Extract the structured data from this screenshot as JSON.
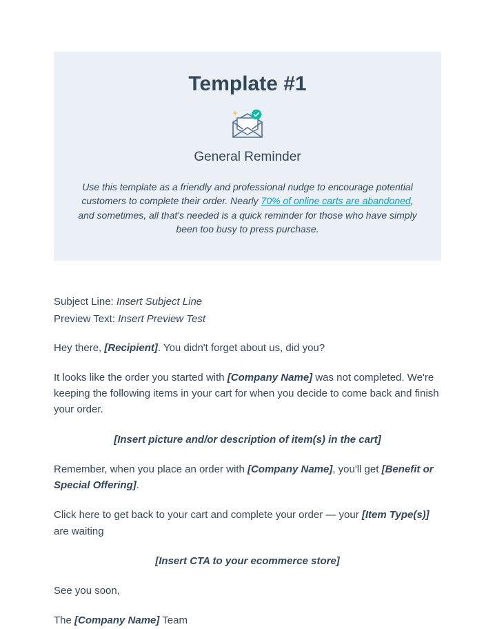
{
  "header": {
    "title": "Template #1",
    "subtitle": "General Reminder",
    "intro_pre": "Use this template as a friendly and professional nudge to encourage potential customers to complete their order. Nearly ",
    "intro_link": "70% of online carts are abandoned",
    "intro_post": ", and sometimes, all that's needed is a quick reminder for those who have simply been too busy to press purchase."
  },
  "meta": {
    "subject_label": "Subject Line: ",
    "subject_value": "Insert Subject Line",
    "preview_label": "Preview Text: ",
    "preview_value": "Insert Preview Test"
  },
  "body": {
    "greeting_pre": "Hey there, ",
    "greeting_recipient": "[Recipient]",
    "greeting_post": ". You didn't forget about us, did you?",
    "p2_pre": "It looks like the order you started with ",
    "p2_company": "[Company Name]",
    "p2_post": " was not completed. We're keeping the following items in your cart for when you decide to come back and finish your order.",
    "insert_picture": "[Insert picture and/or description of item(s) in the cart]",
    "p4_pre": "Remember, when you place an order with ",
    "p4_company": "[Company Name]",
    "p4_mid": ", you'll get ",
    "p4_benefit": "[Benefit or Special Offering]",
    "p4_post": ".",
    "p5_pre": "Click here to get back to your cart and complete your order — your ",
    "p5_item": "[Item Type(s)]",
    "p5_post": " are waiting",
    "insert_cta": "[Insert CTA to your ecommerce store]",
    "signoff": "See you soon,",
    "closing_pre": "The ",
    "closing_company": "[Company Name]",
    "closing_post": " Team"
  }
}
